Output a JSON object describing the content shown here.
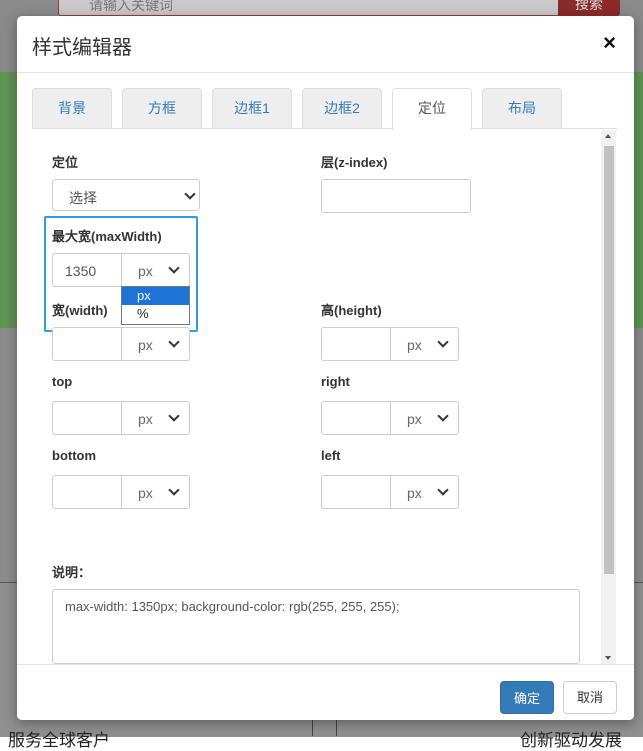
{
  "background": {
    "search_placeholder": "请输入关键词",
    "search_button": "搜索",
    "footer_left_text": "服务全球客户",
    "footer_right_text": "创新驱动发展"
  },
  "dialog": {
    "title": "样式编辑器",
    "close_icon": "close-icon",
    "tabs": [
      "背景",
      "方框",
      "边框1",
      "边框2",
      "定位",
      "布局"
    ],
    "active_tab": "定位"
  },
  "form": {
    "position_label": "定位",
    "position_value": "选择",
    "zindex_label": "层(z-index)",
    "zindex_value": "",
    "maxwidth_label": "最大宽(maxWidth)",
    "maxwidth_value": "1350",
    "maxwidth_unit": "px",
    "unit_options": [
      "px",
      "%"
    ],
    "unit_selected": "px",
    "width_label": "宽(width)",
    "width_unit": "px",
    "height_label": "高(height)",
    "height_unit": "px",
    "top_label": "top",
    "top_unit": "px",
    "right_label": "right",
    "right_unit": "px",
    "bottom_label": "bottom",
    "bottom_unit": "px",
    "left_label": "left",
    "left_unit": "px",
    "description_label": "说明：",
    "description_value": "max-width: 1350px; background-color: rgb(255, 255, 255);"
  },
  "footer": {
    "ok_label": "确定",
    "cancel_label": "取消"
  },
  "colors": {
    "accent": "#337ab7",
    "focus_border": "#2d9ee0",
    "selected_option": "#1e74d6"
  }
}
